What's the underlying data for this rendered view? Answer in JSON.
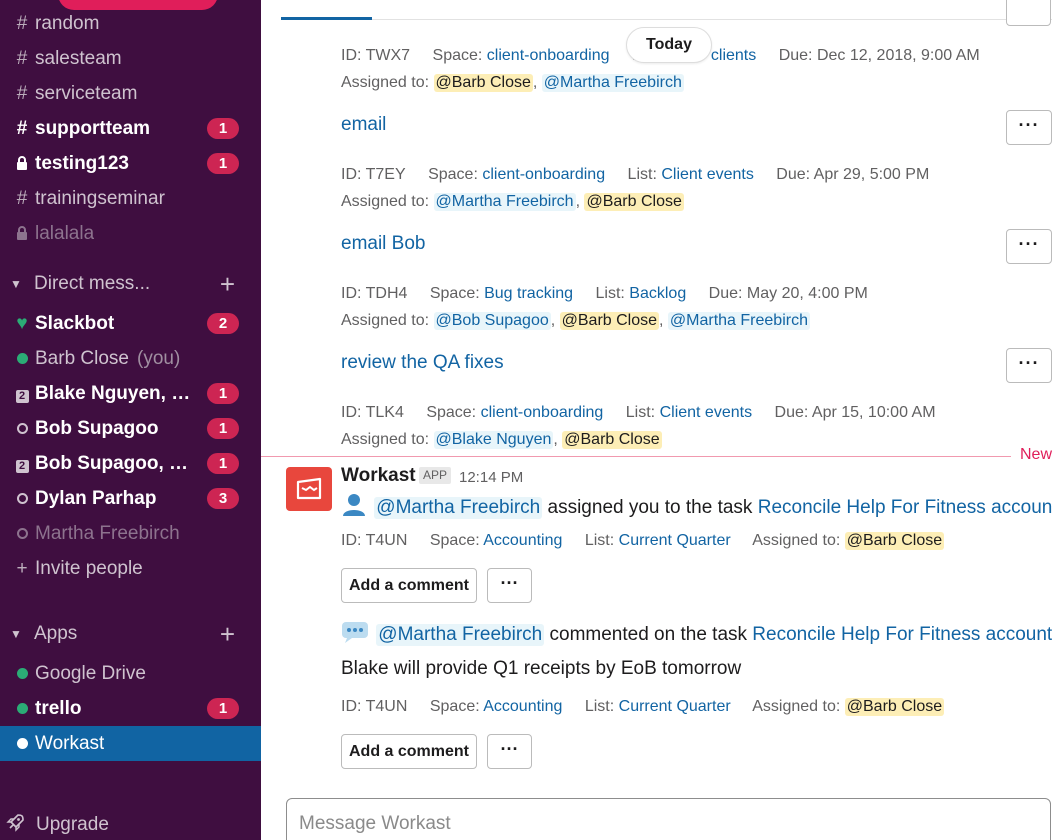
{
  "sidebar": {
    "channels": [
      {
        "prefix": "#",
        "label": "random",
        "state": "normal"
      },
      {
        "prefix": "#",
        "label": "salesteam",
        "state": "normal"
      },
      {
        "prefix": "#",
        "label": "serviceteam",
        "state": "normal"
      },
      {
        "prefix": "#",
        "label": "supportteam",
        "state": "unread",
        "badge": "1"
      },
      {
        "prefix": "lock",
        "label": "testing123",
        "state": "unread",
        "badge": "1"
      },
      {
        "prefix": "#",
        "label": "trainingseminar",
        "state": "normal"
      },
      {
        "prefix": "lock",
        "label": "lalalala",
        "state": "muted"
      }
    ],
    "dm_section": {
      "title": "Direct mess...",
      "add": "+"
    },
    "dms": [
      {
        "label": "Slackbot",
        "badge": "2"
      },
      {
        "label": "Barb Close",
        "suffix": "(you)"
      },
      {
        "label": "Blake Nguyen, Bo...",
        "badge": "1",
        "group_count": "2"
      },
      {
        "label": "Bob Supagoo",
        "badge": "1"
      },
      {
        "label": "Bob Supagoo, Ma...",
        "badge": "1",
        "group_count": "2"
      },
      {
        "label": "Dylan Parhap",
        "badge": "3"
      },
      {
        "label": "Martha Freebirch"
      },
      {
        "label": "Invite people",
        "prefix": "+"
      }
    ],
    "apps_section": {
      "title": "Apps",
      "add": "+"
    },
    "apps": [
      {
        "label": "Google Drive"
      },
      {
        "label": "trello",
        "badge": "1"
      },
      {
        "label": "Workast",
        "active": true
      }
    ],
    "upgrade": "Upgrade"
  },
  "main": {
    "today": "Today",
    "tasks": [
      {
        "id_label": "ID:",
        "id": "TWX7",
        "space_label": "Space:",
        "space": "client-onboarding",
        "list_label": "L",
        "list": "clients",
        "due_label": "Due:",
        "due": "Dec 12, 2018, 9:00 AM",
        "assigned_label": "Assigned to:",
        "assignees": [
          "@Barb Close",
          "@Martha Freebirch"
        ]
      },
      {
        "title": "email",
        "id_label": "ID:",
        "id": "T7EY",
        "space_label": "Space:",
        "space": "client-onboarding",
        "list_label": "List:",
        "list": "Client events",
        "due_label": "Due:",
        "due": "Apr 29, 5:00 PM",
        "assigned_label": "Assigned to:",
        "assignees": [
          "@Martha Freebirch",
          "@Barb Close"
        ]
      },
      {
        "title": "email Bob",
        "id_label": "ID:",
        "id": "TDH4",
        "space_label": "Space:",
        "space": "Bug tracking",
        "list_label": "List:",
        "list": "Backlog",
        "due_label": "Due:",
        "due": "May 20, 4:00 PM",
        "assigned_label": "Assigned to:",
        "assignees": [
          "@Bob Supagoo",
          "@Barb Close",
          "@Martha Freebirch"
        ]
      },
      {
        "title": "review the QA fixes",
        "id_label": "ID:",
        "id": "TLK4",
        "space_label": "Space:",
        "space": "client-onboarding",
        "list_label": "List:",
        "list": "Client events",
        "due_label": "Due:",
        "due": "Apr 15, 10:00 AM",
        "assigned_label": "Assigned to:",
        "assignees": [
          "@Blake Nguyen",
          "@Barb Close"
        ]
      }
    ],
    "new_label": "New",
    "message": {
      "sender": "Workast",
      "app_badge": "APP",
      "time": "12:14 PM",
      "assign_line": {
        "mention": "@Martha Freebirch",
        "text": "assigned you to the task",
        "task": "Reconcile Help For Fitness account"
      },
      "task_meta": {
        "id_label": "ID:",
        "id": "T4UN",
        "space_label": "Space:",
        "space": "Accounting",
        "list_label": "List:",
        "list": "Current Quarter",
        "assigned_label": "Assigned to:",
        "assignee": "@Barb Close"
      },
      "add_comment": "Add a comment",
      "more": "···",
      "comment_line": {
        "mention": "@Martha Freebirch",
        "text": "commented on the task",
        "task": "Reconcile Help For Fitness account"
      },
      "comment_text": "Blake will provide Q1 receipts by EoB tomorrow"
    },
    "composer": {
      "placeholder": "Message Workast"
    }
  },
  "colors": {
    "sidebar_bg": "#3f0e40",
    "active_bg": "#1164a3",
    "badge": "#cd2553",
    "link": "#1264a3",
    "new_line": "#e01e5a"
  }
}
